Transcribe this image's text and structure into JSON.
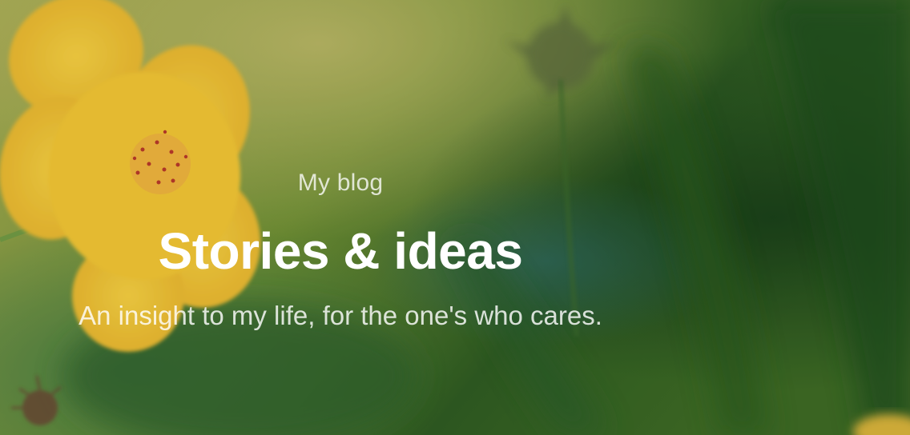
{
  "hero": {
    "eyebrow": "My blog",
    "title": "Stories & ideas",
    "tagline": "An insight to my life, for the one's who cares.",
    "background": {
      "subject": "blurred yellow cosmos flower against green foliage",
      "colors": {
        "flower": "#f2c232",
        "flower_center": "#e8a93a",
        "foliage_dark": "#1f4a1e",
        "foliage_mid": "#4b7a2c",
        "foliage_light": "#a4ad52"
      }
    }
  }
}
